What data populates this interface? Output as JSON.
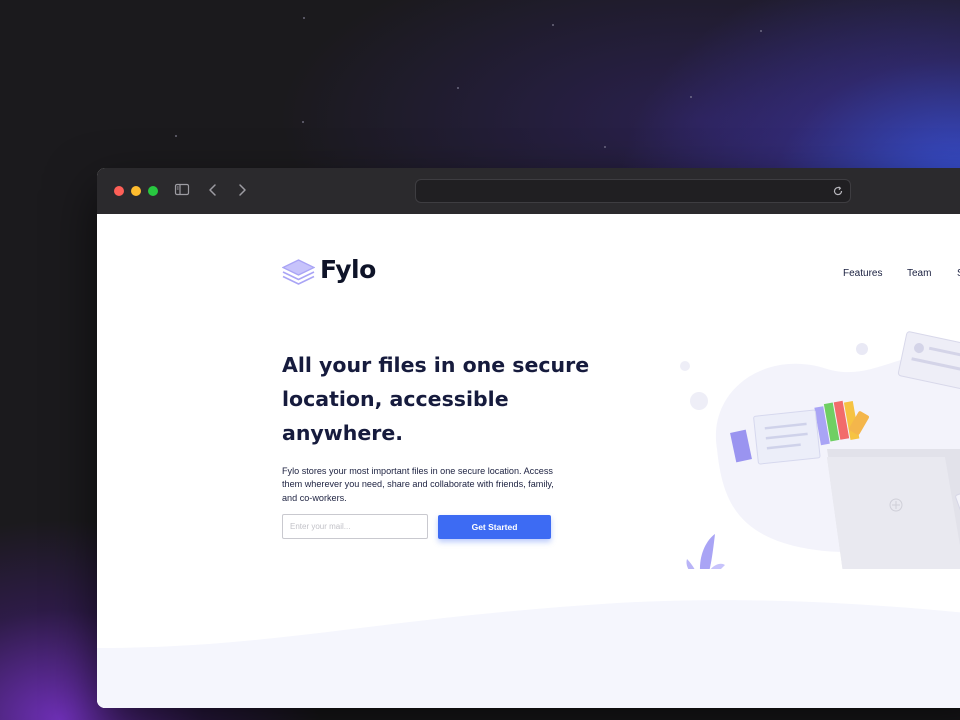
{
  "brand": {
    "name": "Fylo",
    "accent": "#3d6bf3",
    "logo_color": "#a9a4f5"
  },
  "browser": {
    "traffic_lights": [
      "#fe5f57",
      "#febc2e",
      "#28c840"
    ],
    "icons": [
      "sidebar-icon",
      "back-icon",
      "forward-icon",
      "reload-icon"
    ],
    "url": ""
  },
  "nav": {
    "items": [
      "Features",
      "Team",
      "S"
    ]
  },
  "hero": {
    "title_lines": [
      "All your files in one secure",
      "location, accessible",
      "anywhere."
    ],
    "text_lines": [
      "Fylo stores your most important files in one secure location. Access",
      "them wherever you need, share and collaborate with friends, family,",
      "and co-workers."
    ],
    "email_placeholder": "Enter your mail...",
    "cta_label": "Get Started"
  },
  "colors": {
    "heading": "#161b3d",
    "page_bg": "#ffffff",
    "footer_bg": "#f5f6fd"
  }
}
